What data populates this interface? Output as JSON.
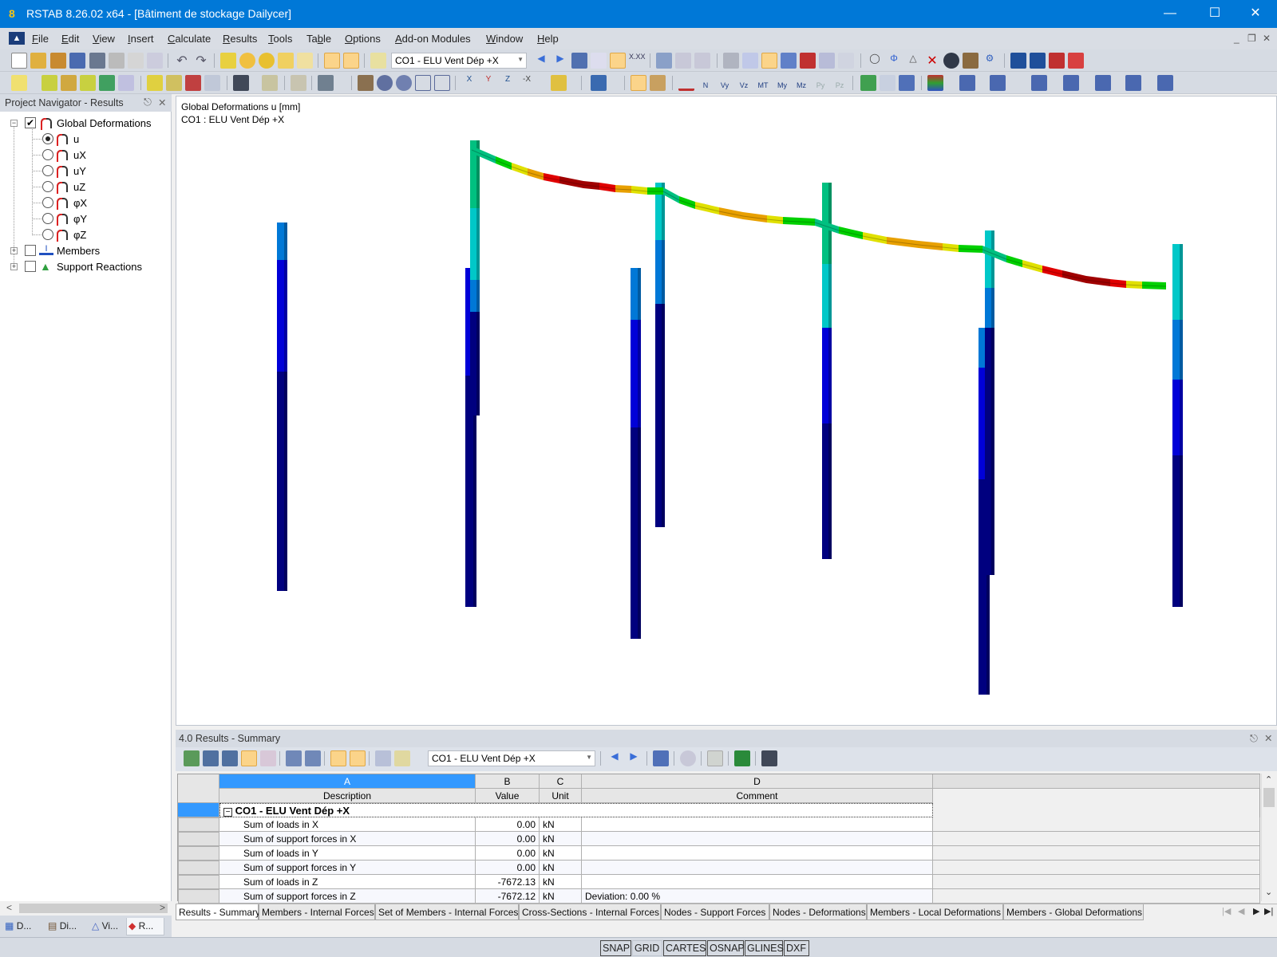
{
  "window": {
    "title": "RSTAB 8.26.02 x64 - [Bâtiment de stockage Dailycer]",
    "app_icon": "rstab-8-icon",
    "controls": [
      "minimize",
      "maximize",
      "close"
    ]
  },
  "menu": {
    "items": [
      {
        "label": "File",
        "accel": "F"
      },
      {
        "label": "Edit",
        "accel": "E"
      },
      {
        "label": "View",
        "accel": "V"
      },
      {
        "label": "Insert",
        "accel": "I"
      },
      {
        "label": "Calculate",
        "accel": "C"
      },
      {
        "label": "Results",
        "accel": "R"
      },
      {
        "label": "Tools",
        "accel": "T"
      },
      {
        "label": "Table",
        "accel": "b"
      },
      {
        "label": "Options",
        "accel": "O"
      },
      {
        "label": "Add-on Modules",
        "accel": "A"
      },
      {
        "label": "Window",
        "accel": "W"
      },
      {
        "label": "Help",
        "accel": "H"
      }
    ]
  },
  "toolbar": {
    "load_case_combo": "CO1 - ELU Vent Dép +X",
    "internal_force_labels": [
      "N",
      "Vy",
      "Vz",
      "MT",
      "My",
      "Mz",
      "Py",
      "Pz"
    ]
  },
  "navigator": {
    "title": "Project Navigator - Results",
    "tree": {
      "global_deformations": {
        "label": "Global Deformations",
        "checked": true,
        "expanded": true
      },
      "options": [
        {
          "label": "u",
          "selected": true
        },
        {
          "label": "uX",
          "selected": false
        },
        {
          "label": "uY",
          "selected": false
        },
        {
          "label": "uZ",
          "selected": false
        },
        {
          "label": "φX",
          "selected": false
        },
        {
          "label": "φY",
          "selected": false
        },
        {
          "label": "φZ",
          "selected": false
        }
      ],
      "members": {
        "label": "Members",
        "checked": false
      },
      "support_reactions": {
        "label": "Support Reactions",
        "checked": false
      }
    },
    "tabs": [
      {
        "label": "D...",
        "icon": "data-icon"
      },
      {
        "label": "Di...",
        "icon": "display-icon"
      },
      {
        "label": "Vi...",
        "icon": "views-icon"
      },
      {
        "label": "R...",
        "icon": "results-icon",
        "selected": true
      }
    ]
  },
  "viewport": {
    "line1": "Global Deformations u [mm]",
    "line2": "CO1 : ELU Vent Dép +X",
    "color_scale": [
      "#00007f",
      "#0000d8",
      "#0078d7",
      "#00c8c8",
      "#00c080",
      "#00d000",
      "#e0e000",
      "#e8a000",
      "#e00000",
      "#a00000"
    ]
  },
  "results": {
    "title": "4.0 Results - Summary",
    "combo": "CO1 - ELU Vent Dép +X",
    "columns": [
      {
        "letter": "A",
        "label": "Description"
      },
      {
        "letter": "B",
        "label": "Value"
      },
      {
        "letter": "C",
        "label": "Unit"
      },
      {
        "letter": "D",
        "label": "Comment"
      }
    ],
    "group": "CO1 - ELU Vent Dép +X",
    "rows": [
      {
        "description": "Sum of loads in X",
        "value": "0.00",
        "unit": "kN",
        "comment": ""
      },
      {
        "description": "Sum of support forces in X",
        "value": "0.00",
        "unit": "kN",
        "comment": ""
      },
      {
        "description": "Sum of loads in Y",
        "value": "0.00",
        "unit": "kN",
        "comment": ""
      },
      {
        "description": "Sum of support forces in Y",
        "value": "0.00",
        "unit": "kN",
        "comment": ""
      },
      {
        "description": "Sum of loads in Z",
        "value": "-7672.13",
        "unit": "kN",
        "comment": ""
      },
      {
        "description": "Sum of support forces in Z",
        "value": "-7672.12",
        "unit": "kN",
        "comment": "Deviation:  0.00 %"
      }
    ]
  },
  "bottom_tabs": [
    {
      "label": "Results - Summary",
      "selected": true
    },
    {
      "label": "Members - Internal Forces"
    },
    {
      "label": "Set of Members - Internal Forces"
    },
    {
      "label": "Cross-Sections - Internal Forces"
    },
    {
      "label": "Nodes - Support Forces"
    },
    {
      "label": "Nodes - Deformations"
    },
    {
      "label": "Members - Local Deformations"
    },
    {
      "label": "Members - Global Deformations"
    }
  ],
  "status": {
    "toggles": [
      {
        "label": "SNAP",
        "on": true
      },
      {
        "label": "GRID",
        "on": false
      },
      {
        "label": "CARTES",
        "on": true
      },
      {
        "label": "OSNAP",
        "on": true
      },
      {
        "label": "GLINES",
        "on": true
      },
      {
        "label": "DXF",
        "on": true
      }
    ]
  }
}
